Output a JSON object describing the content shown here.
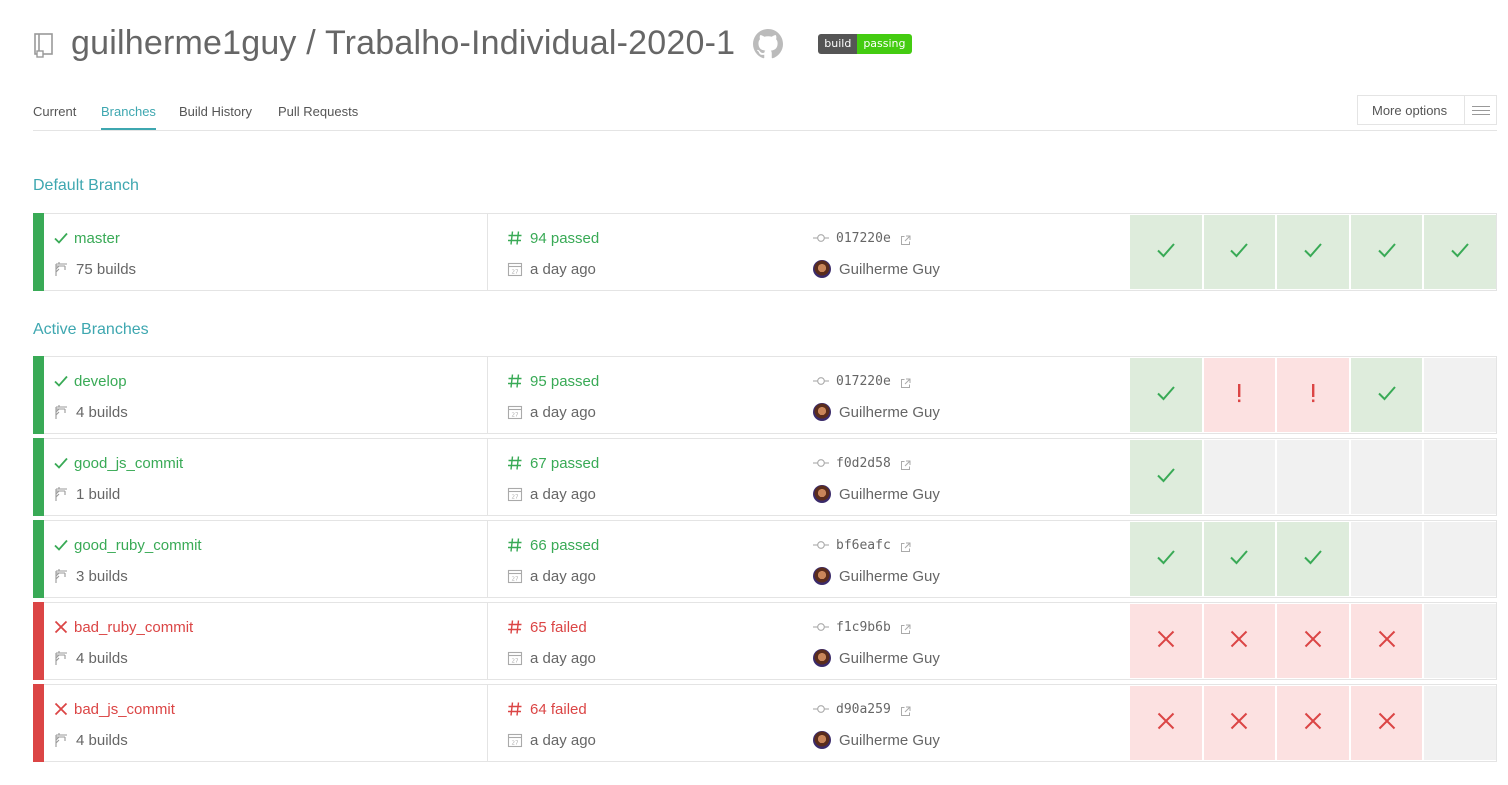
{
  "header": {
    "repo_title": "guilherme1guy / Trabalho-Individual-2020-1",
    "badge_left": "build",
    "badge_right": "passing"
  },
  "tabs": [
    {
      "label": "Current",
      "active": false
    },
    {
      "label": "Branches",
      "active": true
    },
    {
      "label": "Build History",
      "active": false
    },
    {
      "label": "Pull Requests",
      "active": false
    }
  ],
  "more_options": {
    "label": "More options"
  },
  "sections": {
    "default": "Default Branch",
    "active": "Active Branches"
  },
  "branches": [
    {
      "name": "master",
      "status": "passed",
      "builds": "75 builds",
      "build": "94 passed",
      "time": "a day ago",
      "sha": "017220e",
      "author": "Guilherme Guy",
      "history": [
        "passed",
        "passed",
        "passed",
        "passed",
        "passed"
      ]
    },
    {
      "name": "develop",
      "status": "passed",
      "builds": "4 builds",
      "build": "95 passed",
      "time": "a day ago",
      "sha": "017220e",
      "author": "Guilherme Guy",
      "history": [
        "passed",
        "errored",
        "errored",
        "passed",
        "empty"
      ]
    },
    {
      "name": "good_js_commit",
      "status": "passed",
      "builds": "1 build",
      "build": "67 passed",
      "time": "a day ago",
      "sha": "f0d2d58",
      "author": "Guilherme Guy",
      "history": [
        "passed",
        "empty",
        "empty",
        "empty",
        "empty"
      ]
    },
    {
      "name": "good_ruby_commit",
      "status": "passed",
      "builds": "3 builds",
      "build": "66 passed",
      "time": "a day ago",
      "sha": "bf6eafc",
      "author": "Guilherme Guy",
      "history": [
        "passed",
        "passed",
        "passed",
        "empty",
        "empty"
      ]
    },
    {
      "name": "bad_ruby_commit",
      "status": "failed",
      "builds": "4 builds",
      "build": "65 failed",
      "time": "a day ago",
      "sha": "f1c9b6b",
      "author": "Guilherme Guy",
      "history": [
        "failed",
        "failed",
        "failed",
        "failed",
        "empty"
      ]
    },
    {
      "name": "bad_js_commit",
      "status": "failed",
      "builds": "4 builds",
      "build": "64 failed",
      "time": "a day ago",
      "sha": "d90a259",
      "author": "Guilherme Guy",
      "history": [
        "failed",
        "failed",
        "failed",
        "failed",
        "empty"
      ]
    }
  ],
  "colors": {
    "passed": "#39aa56",
    "failed": "#db4545",
    "accent": "#3ea7b0"
  }
}
